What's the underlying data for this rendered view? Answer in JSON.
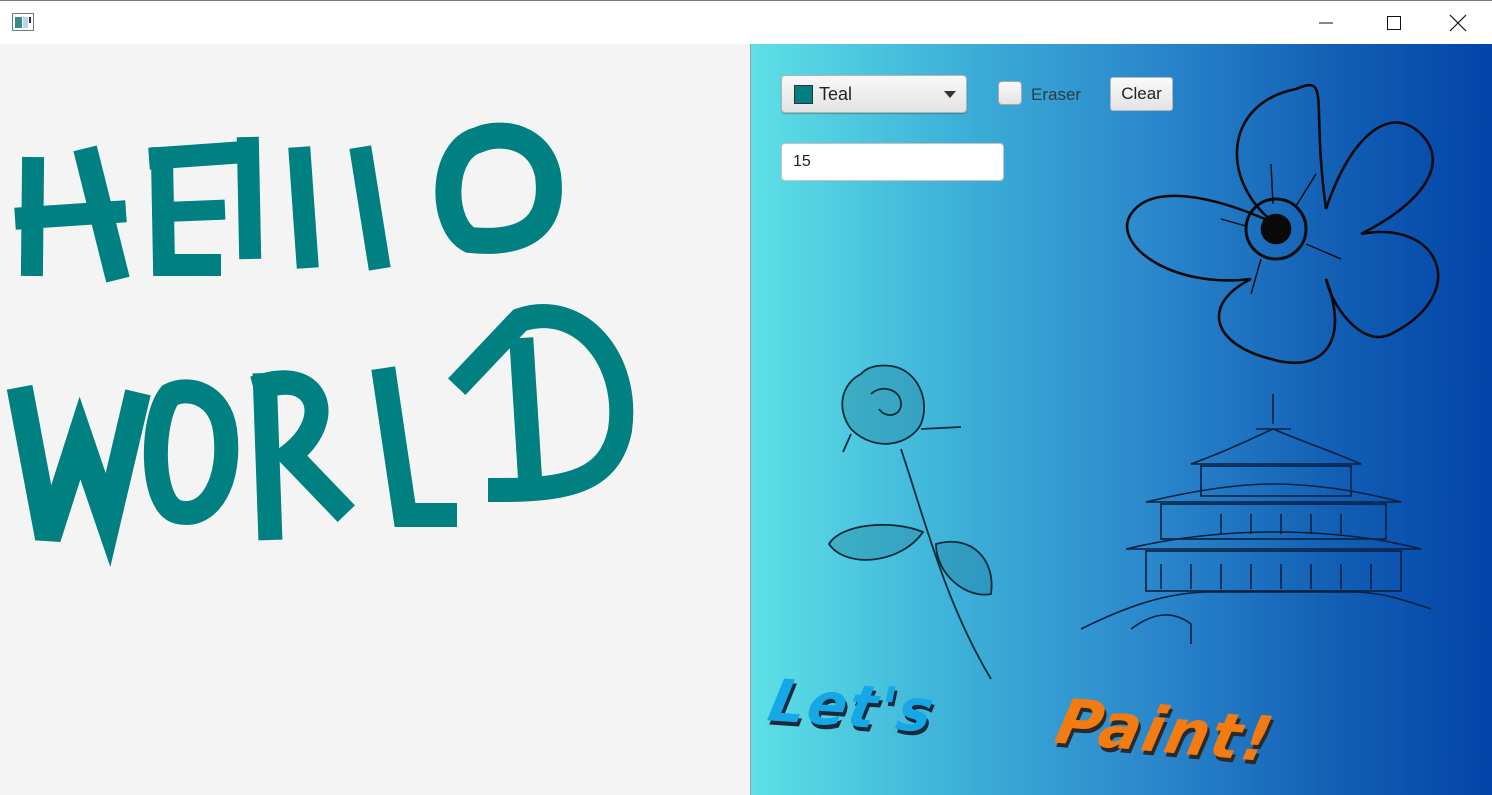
{
  "window": {
    "title": "",
    "buttons": {
      "minimize_icon": "minimize-icon",
      "maximize_icon": "maximize-icon",
      "close_icon": "close-icon"
    }
  },
  "canvas": {
    "background": "#f4f4f4",
    "stroke_color": "#008080",
    "drawn_text": "HEllO WORLD"
  },
  "controls": {
    "color_picker": {
      "selected_label": "Teal",
      "selected_color": "#008080"
    },
    "eraser": {
      "label": "Eraser",
      "checked": false
    },
    "clear_label": "Clear",
    "brush_size_value": "15"
  },
  "decorations": {
    "lets_text": "Let's",
    "paint_text": "Paint!",
    "gradient": [
      "#5ee0e6",
      "#0244a8"
    ],
    "images": [
      "flower-sketch",
      "rose-sketch",
      "pagoda-sketch"
    ]
  }
}
